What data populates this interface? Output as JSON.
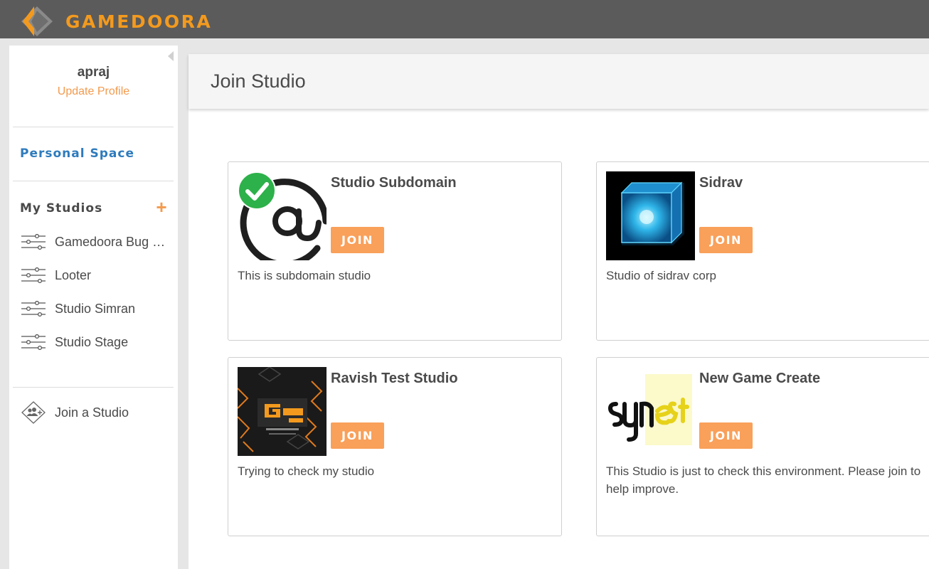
{
  "brand": {
    "name": "GAMEDOORA",
    "accent": "#f39a1e"
  },
  "sidebar": {
    "user_name": "apraj",
    "update_profile": "Update Profile",
    "personal_space": "Personal Space",
    "my_studios_title": "My Studios",
    "add_icon": "plus-icon",
    "studios": [
      {
        "label": "Gamedoora Bug …",
        "icon": "sliders-icon"
      },
      {
        "label": "Looter",
        "icon": "sliders-icon"
      },
      {
        "label": "Studio Simran",
        "icon": "sliders-icon"
      },
      {
        "label": "Studio Stage",
        "icon": "sliders-icon"
      }
    ],
    "join_studio": {
      "label": "Join a Studio",
      "icon": "group-add-icon"
    }
  },
  "main": {
    "title": "Join Studio",
    "cards": [
      {
        "name": "Studio Subdomain",
        "button": "JOIN",
        "description": "This is subdomain studio",
        "image": "at-sign-with-checkmark-logo"
      },
      {
        "name": "Sidrav",
        "button": "JOIN",
        "description": "Studio of sidrav corp",
        "image": "glowing-blue-cube-logo"
      },
      {
        "name": "Ravish Test Studio",
        "button": "JOIN",
        "description": "Trying to check my studio",
        "image": "gamefest-2016-poster"
      },
      {
        "name": "New Game Create",
        "button": "JOIN",
        "description": "This Studio is just to check this environment. Please join to help improve.",
        "image": "synestudio-logo"
      }
    ]
  },
  "colors": {
    "topbar": "#5b5b5b",
    "join_button": "#f9a05a",
    "link_orange": "#f39a4d",
    "personal_space_blue": "#2e7bbd"
  }
}
